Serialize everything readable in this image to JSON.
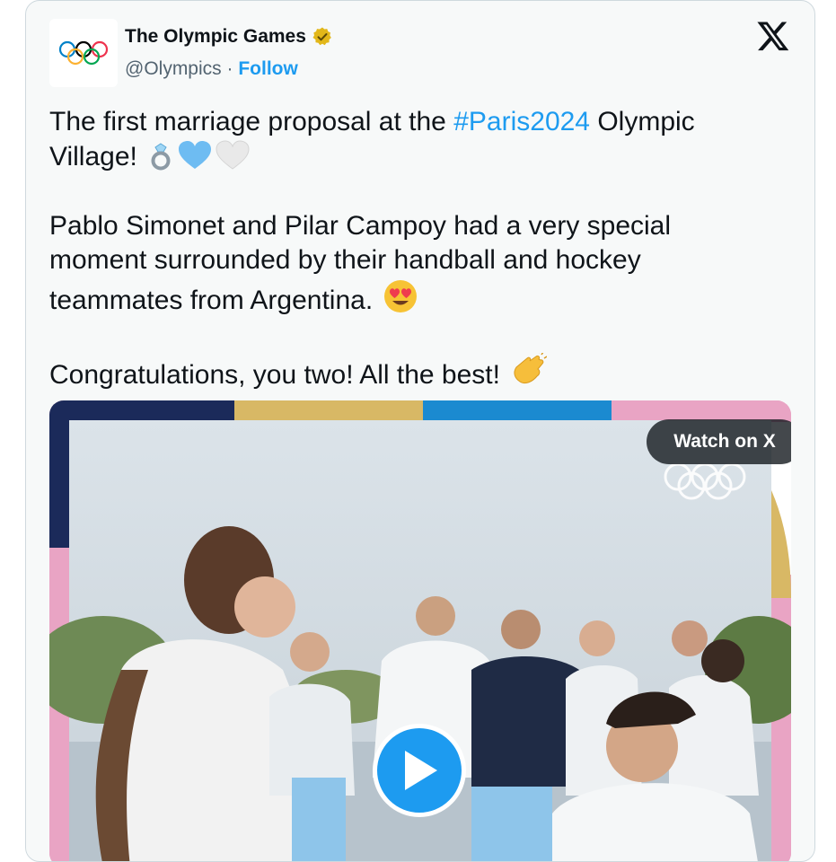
{
  "account": {
    "name": "The Olympic Games",
    "handle": "@Olympics",
    "separator": " · ",
    "follow_label": "Follow",
    "verified_icon": "gold-verified-badge-icon",
    "avatar_icon": "olympic-rings-icon"
  },
  "platform": {
    "logo_icon": "x-logo-icon"
  },
  "tweet": {
    "line1_before": "The first marriage proposal at the ",
    "hashtag": "#Paris2024",
    "line1_after": " Olympic Village!",
    "emojis_1": [
      "ring",
      "light-blue-heart",
      "white-heart"
    ],
    "paragraph2": "Pablo Simonet and Pilar Campoy had a very special moment surrounded by their handball and hockey teammates from Argentina.",
    "emoji_2": "heart-eyes",
    "paragraph3": "Congratulations, you two! All the best!",
    "emoji_3": "clapping-hands"
  },
  "media": {
    "watch_label": "Watch on X",
    "play_icon": "play-icon"
  },
  "colors": {
    "link_blue": "#1d9bf0",
    "text": "#0f1419",
    "secondary_text": "#536471",
    "card_background": "#f7f9f9",
    "verified_gold": "#e2b719"
  }
}
